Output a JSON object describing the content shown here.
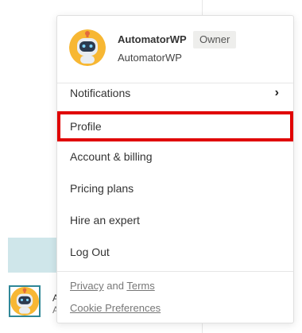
{
  "user": {
    "name": "AutomatorWP",
    "role": "Owner",
    "organization": "AutomatorWP"
  },
  "menu": {
    "items": [
      {
        "label": "Notifications",
        "has_submenu": true
      },
      {
        "label": "Profile",
        "highlighted": true
      },
      {
        "label": "Account & billing"
      },
      {
        "label": "Pricing plans"
      },
      {
        "label": "Hire an expert"
      },
      {
        "label": "Log Out"
      }
    ],
    "footer": {
      "privacy": "Privacy",
      "and": "and",
      "terms": "Terms",
      "cookie": "Cookie Preferences"
    },
    "chevron": "›"
  },
  "background": {
    "text_a": "A",
    "text_b": "A"
  },
  "colors": {
    "highlight_border": "#e00000",
    "avatar_bg": "#f7b733",
    "robot_face": "#e9edf2",
    "background_highlight": "#cfe6ea"
  },
  "icons": {
    "avatar": "robot-avatar-icon",
    "submenu": "chevron-right-icon"
  }
}
